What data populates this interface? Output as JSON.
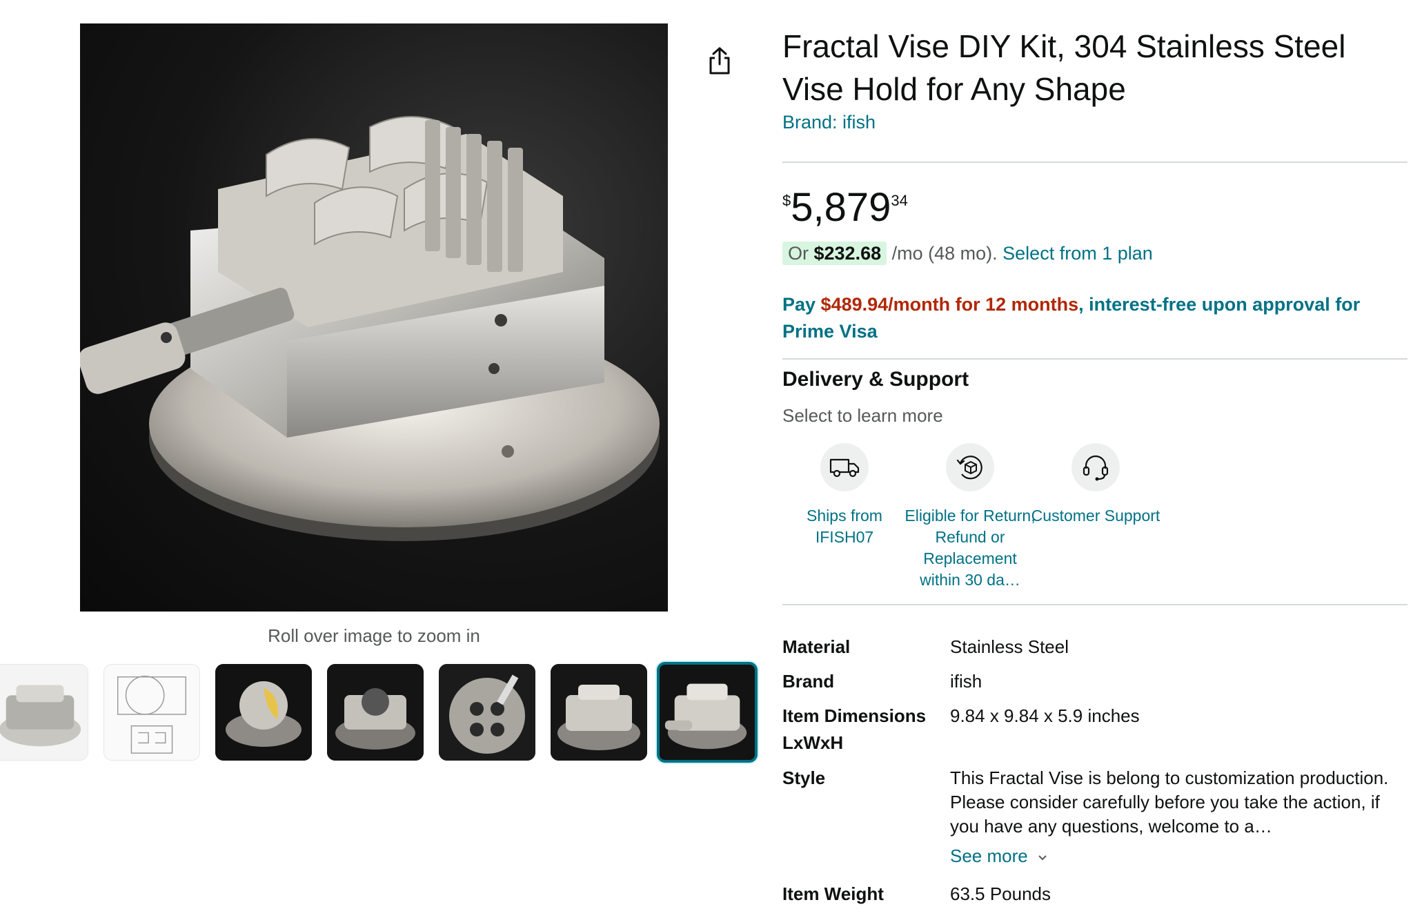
{
  "product": {
    "title": "Fractal Vise DIY Kit, 304 Stainless Steel Vise Hold for Any Shape",
    "brand_link": "Brand: ifish"
  },
  "gallery": {
    "zoom_hint": "Roll over image to zoom in",
    "thumbnail_count": 7,
    "selected_index": 6
  },
  "price": {
    "symbol": "$",
    "whole": "5,879",
    "fraction": "34"
  },
  "installment": {
    "or_label": "Or ",
    "amount": "$232.68",
    "term": " /mo (48 mo). ",
    "plan_link": "Select from 1 plan"
  },
  "promo": {
    "pay_label": "Pay ",
    "amount": "$489.94/month for 12 months",
    "rest": ", interest-free upon approval for Prime Visa"
  },
  "delivery": {
    "title": "Delivery & Support",
    "subtitle": "Select to learn more",
    "items": [
      {
        "label": "Ships from IFISH07",
        "icon": "truck-icon"
      },
      {
        "label": "Eligible for Return, Refund or Replacement within 30 da…",
        "icon": "return-box-icon"
      },
      {
        "label": "Customer Support",
        "icon": "headset-icon"
      }
    ]
  },
  "specs": [
    {
      "key": "Material",
      "value": "Stainless Steel"
    },
    {
      "key": "Brand",
      "value": "ifish"
    },
    {
      "key": "Item Dimensions LxWxH",
      "value": "9.84 x 9.84 x 5.9 inches"
    },
    {
      "key": "Style",
      "value": "This Fractal Vise is belong to customization production. Please consider carefully before you take the action, if you have any questions, welcome to a…"
    },
    {
      "key": "Item Weight",
      "value": "63.5 Pounds"
    }
  ],
  "see_more": "See more",
  "colors": {
    "link": "#007185",
    "price_red": "#b12704",
    "badge_green": "#d7f5df",
    "selected_border": "#007185"
  }
}
